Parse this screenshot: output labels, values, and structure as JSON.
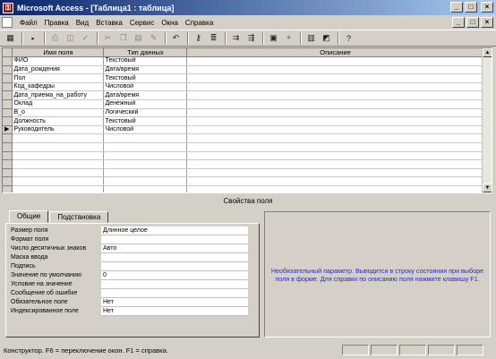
{
  "window": {
    "title": "Microsoft Access - [Таблица1 : таблица]",
    "app_icon": "access-key-icon",
    "controls": [
      "_",
      "□",
      "×"
    ]
  },
  "menu": [
    "Файл",
    "Правка",
    "Вид",
    "Вставка",
    "Сервис",
    "Окна",
    "Справка"
  ],
  "toolbar_icons": [
    "view-icon",
    "save-icon",
    "print-icon",
    "print-preview-icon",
    "spelling-icon",
    "cut-icon",
    "copy-icon",
    "paste-icon",
    "format-painter-icon",
    "undo-icon",
    "primary-key-icon",
    "indexes-icon",
    "insert-rows-icon",
    "delete-rows-icon",
    "properties-icon",
    "build-icon",
    "database-window-icon",
    "new-object-icon",
    "help-icon"
  ],
  "grid": {
    "headers": [
      "Имя поля",
      "Тип данных",
      "Описание"
    ],
    "rows": [
      {
        "name": "ФИО",
        "type": "Текстовый",
        "desc": ""
      },
      {
        "name": "Дата_рождения",
        "type": "Дата/время",
        "desc": ""
      },
      {
        "name": "Пол",
        "type": "Текстовый",
        "desc": ""
      },
      {
        "name": "Код_кафедры",
        "type": "Числовой",
        "desc": ""
      },
      {
        "name": "Дата_приема_на_работу",
        "type": "Дата/время",
        "desc": ""
      },
      {
        "name": "Оклад",
        "type": "Денежный",
        "desc": ""
      },
      {
        "name": "В_о",
        "type": "Логический",
        "desc": ""
      },
      {
        "name": "Должность",
        "type": "Текстовый",
        "desc": ""
      },
      {
        "name": "Руководитель",
        "type": "Числовой",
        "desc": ""
      }
    ],
    "current_row_index": 8,
    "empty_rows": 7
  },
  "properties": {
    "header": "Свойства поля",
    "tabs": [
      "Общие",
      "Подстановка"
    ],
    "active_tab": 0,
    "rows": [
      {
        "label": "Размер поля",
        "value": "Длинное целое"
      },
      {
        "label": "Формат поля",
        "value": ""
      },
      {
        "label": "Число десятичных знаков",
        "value": "Авто"
      },
      {
        "label": "Маска ввода",
        "value": ""
      },
      {
        "label": "Подпись",
        "value": ""
      },
      {
        "label": "Значение по умолчанию",
        "value": "0"
      },
      {
        "label": "Условие на значение",
        "value": ""
      },
      {
        "label": "Сообщение об ошибке",
        "value": ""
      },
      {
        "label": "Обязательное поле",
        "value": "Нет"
      },
      {
        "label": "Индексированное поле",
        "value": "Нет"
      }
    ]
  },
  "help_text": "Необязательный параметр. Выводится в строку состояния при выборе поля в форме. Для справки по описанию поля нажмите клавишу F1.",
  "status": "Конструктор. F6 = переключение окон. F1 = справка."
}
